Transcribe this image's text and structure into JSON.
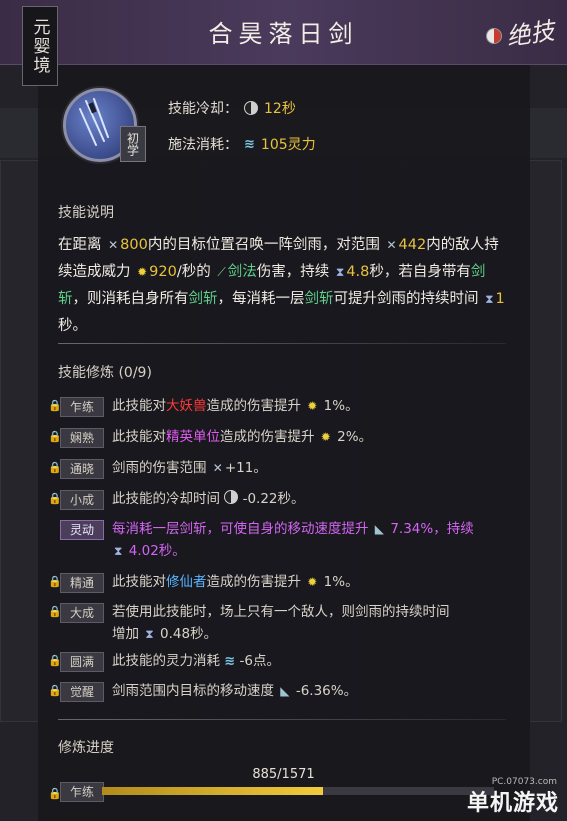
{
  "header": {
    "realm": "元婴境",
    "title": "合昊落日剑",
    "ult_label": "绝技"
  },
  "skill": {
    "rank": "初学",
    "cooldown_label": "技能冷却：",
    "cooldown_value": "12秒",
    "cost_label": "施法消耗：",
    "cost_value": "105灵力"
  },
  "description": {
    "title": "技能说明",
    "p1": "在距离",
    "range1": "800",
    "p2": "内的目标位置召唤一阵剑雨，对范围",
    "range2": "442",
    "p3": "内的敌人持续造成威力",
    "power": "920",
    "p4": "/秒的",
    "school": "剑法",
    "p5": "伤害，持续",
    "dur": "4.8",
    "p6": "秒，若自身带有",
    "kw1": "剑斩",
    "p7": "，则消耗自身所有",
    "kw2": "剑斩",
    "p8": "，每消耗一层",
    "kw3": "剑斩",
    "p9": "可提升剑雨的持续时间",
    "dur2": "1",
    "p10": "秒。"
  },
  "training": {
    "title": "技能修炼 (0/9)",
    "rows": [
      {
        "tag": "乍练",
        "a": "此技能对",
        "k": "大妖兽",
        "b": "造成的伤害提升",
        "v": "1%。"
      },
      {
        "tag": "娴熟",
        "a": "此技能对",
        "k": "精英单位",
        "b": "造成的伤害提升",
        "v": "2%。"
      },
      {
        "tag": "通晓",
        "a": "剑雨的伤害范围",
        "v": "+11。"
      },
      {
        "tag": "小成",
        "a": "此技能的冷却时间",
        "v": "-0.22秒。"
      },
      {
        "tag": "灵动",
        "a": "每消耗一层剑斩，可使自身的移动速度提升",
        "v1": "7.34%，持续",
        "v2": "4.02秒。"
      },
      {
        "tag": "精通",
        "a": "此技能对",
        "k": "修仙者",
        "b": "造成的伤害提升",
        "v": "1%。"
      },
      {
        "tag": "大成",
        "a": "若使用此技能时，场上只有一个敌人，则剑雨的持续时间",
        "a2": "增加",
        "v": "0.48秒。"
      },
      {
        "tag": "圆满",
        "a": "此技能的灵力消耗",
        "v": "-6点。"
      },
      {
        "tag": "觉醒",
        "a": "剑雨范围内目标的移动速度",
        "v": "-6.36%。"
      }
    ]
  },
  "progress": {
    "label": "修炼进度",
    "current": 885,
    "max": 1571,
    "text": "885/1571",
    "tag": "乍练"
  },
  "watermark": {
    "site": "PC.07073.com",
    "brand": "单机游戏"
  },
  "colors": {
    "accent": "#e8c23c",
    "keyword_green": "#5fcf8a",
    "header": "#4b3a5c"
  }
}
